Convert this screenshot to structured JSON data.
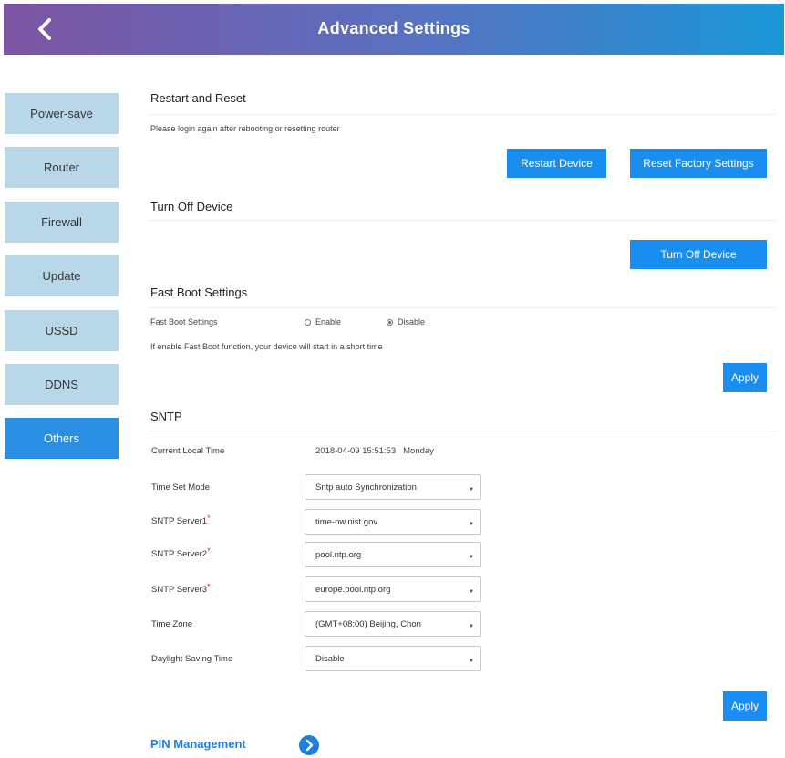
{
  "header": {
    "title": "Advanced Settings",
    "back_icon": "chevron-left-icon"
  },
  "sidebar": {
    "items": [
      {
        "label": "Power-save",
        "active": false
      },
      {
        "label": "Router",
        "active": false
      },
      {
        "label": "Firewall",
        "active": false
      },
      {
        "label": "Update",
        "active": false
      },
      {
        "label": "USSD",
        "active": false
      },
      {
        "label": "DDNS",
        "active": false
      },
      {
        "label": "Others",
        "active": true
      }
    ]
  },
  "restart": {
    "title": "Restart and Reset",
    "note": "Please login again after rebooting or resetting router",
    "restart_button": "Restart Device",
    "reset_button": "Reset Factory Settings"
  },
  "turnoff": {
    "title": "Turn Off Device",
    "button": "Turn Off Device"
  },
  "fastboot": {
    "title": "Fast Boot Settings",
    "label": "Fast Boot Settings",
    "option_enable": "Enable",
    "option_disable": "Disable",
    "selected": "Disable",
    "note": "If enable Fast Boot function, your device will start in a short time",
    "apply": "Apply"
  },
  "sntp": {
    "title": "SNTP",
    "current_time_label": "Current Local Time",
    "current_time_value": "2018-04-09 15:51:53   Monday",
    "time_mode_label": "Time Set Mode",
    "time_mode_value": "Sntp auto Synchronization",
    "server1_label": "SNTP Server1",
    "server1_value": "time-nw.nist.gov",
    "server2_label": "SNTP Server2",
    "server2_value": "pool.ntp.org",
    "server3_label": "SNTP Server3",
    "server3_value": "europe.pool.ntp.org",
    "timezone_label": "Time Zone",
    "timezone_value": "(GMT+08:00) Beijing, Chon",
    "dst_label": "Daylight Saving Time",
    "dst_value": "Disable",
    "required_mark": "*",
    "apply": "Apply"
  },
  "pin": {
    "label": "PIN Management",
    "icon": "arrow-right-circle-icon"
  },
  "colors": {
    "accent": "#1a8ef0",
    "sidebar_bg": "#b8d8ea",
    "sidebar_active": "#2a8fe3"
  }
}
